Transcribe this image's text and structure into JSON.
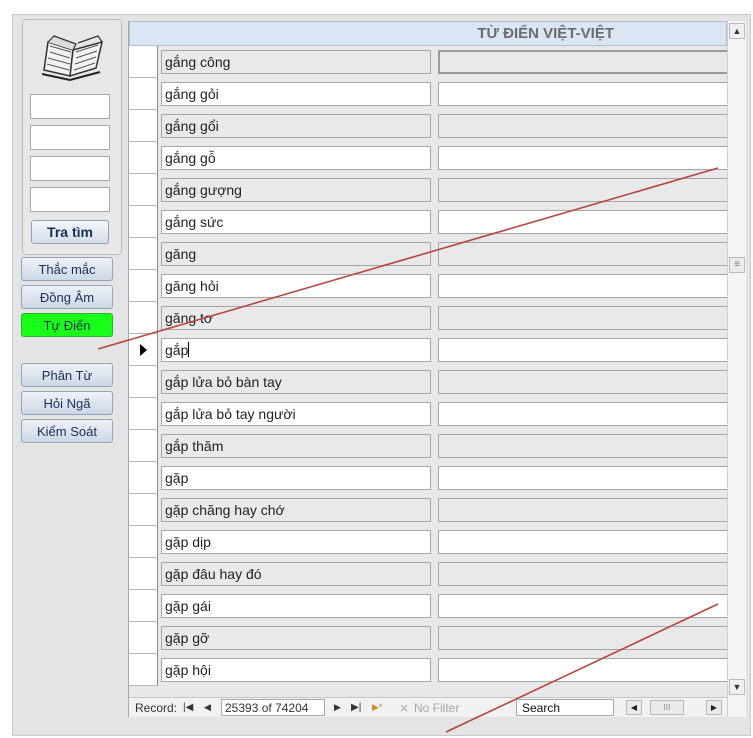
{
  "sidebar": {
    "lookup_inputs": [
      "",
      "",
      "",
      ""
    ],
    "search_button": "Tra tìm",
    "nav_buttons": [
      "Thắc mắc",
      "Đồng Âm",
      "Tự Điển",
      "Phân Từ",
      "Hỏi Ngã",
      "Kiểm Soát"
    ],
    "active_nav": "Tự Điển",
    "active_color": "#1aff1a"
  },
  "datasheet": {
    "title": "TỪ ĐIỂN VIỆT-VIỆT",
    "current_row_index": 9,
    "rows": [
      {
        "word": "gắng công",
        "definition": ""
      },
      {
        "word": "gắng gỏi",
        "definition": ""
      },
      {
        "word": "gắng gổi",
        "definition": ""
      },
      {
        "word": "gắng gỗ",
        "definition": ""
      },
      {
        "word": "gắng gượng",
        "definition": ""
      },
      {
        "word": "gắng sức",
        "definition": ""
      },
      {
        "word": "găng",
        "definition": ""
      },
      {
        "word": "găng hỏi",
        "definition": ""
      },
      {
        "word": "găng tơ",
        "definition": ""
      },
      {
        "word": "gắp",
        "definition": ""
      },
      {
        "word": "gắp lửa bỏ bàn tay",
        "definition": ""
      },
      {
        "word": "gắp lửa bỏ tay người",
        "definition": ""
      },
      {
        "word": "gắp thăm",
        "definition": ""
      },
      {
        "word": "gặp",
        "definition": ""
      },
      {
        "word": "gặp chăng hay chớ",
        "definition": ""
      },
      {
        "word": "gặp dịp",
        "definition": ""
      },
      {
        "word": "gặp đâu hay đó",
        "definition": ""
      },
      {
        "word": "gặp gái",
        "definition": ""
      },
      {
        "word": "gặp gỡ",
        "definition": ""
      },
      {
        "word": "gặp hội",
        "definition": ""
      }
    ]
  },
  "navbar": {
    "record_label": "Record:",
    "first_icon": "|◀",
    "prev_icon": "◀",
    "record_value": "25393 of 74204",
    "next_icon": "▶",
    "last_icon": "▶|",
    "new_icon": "▶*",
    "filter_label": "No Filter",
    "search_label": "Search",
    "scroll_left_icon": "◀",
    "scroll_grip_icon": "III",
    "scroll_right_icon": "▶"
  },
  "icons": {
    "book": "open-book-icon",
    "scroll_up": "▲",
    "scroll_down": "▼",
    "scroll_grip": "≡"
  }
}
